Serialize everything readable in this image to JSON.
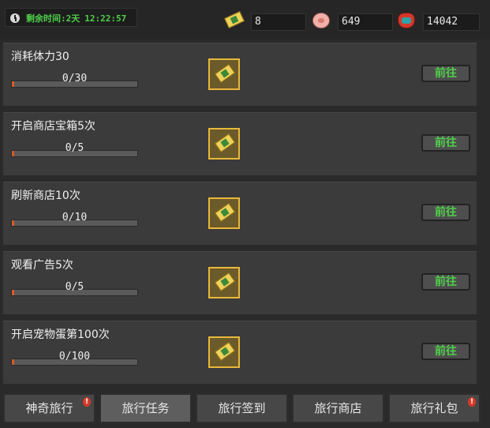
{
  "header": {
    "timer_label": "剩余时间:2天",
    "timer_value": "12:22:57",
    "tickets": "8",
    "pig_coins": "649",
    "bag_coins": "14042"
  },
  "tasks": [
    {
      "title": "消耗体力30",
      "progress": "0/30",
      "fraction": 0,
      "action": "前往"
    },
    {
      "title": "开启商店宝箱5次",
      "progress": "0/5",
      "fraction": 0,
      "action": "前往"
    },
    {
      "title": "刷新商店10次",
      "progress": "0/10",
      "fraction": 0,
      "action": "前往"
    },
    {
      "title": "观看广告5次",
      "progress": "0/5",
      "fraction": 0,
      "action": "前往"
    },
    {
      "title": "开启宠物蛋第100次",
      "progress": "0/100",
      "fraction": 0,
      "action": "前往"
    }
  ],
  "tabs": [
    {
      "label": "神奇旅行",
      "badge": "!"
    },
    {
      "label": "旅行任务"
    },
    {
      "label": "旅行签到"
    },
    {
      "label": "旅行商店"
    },
    {
      "label": "旅行礼包",
      "badge": "!"
    }
  ],
  "colors": {
    "accent_green": "#4fd14a",
    "progress_orange": "#d85a2a",
    "reward_border": "#e8b83a"
  }
}
